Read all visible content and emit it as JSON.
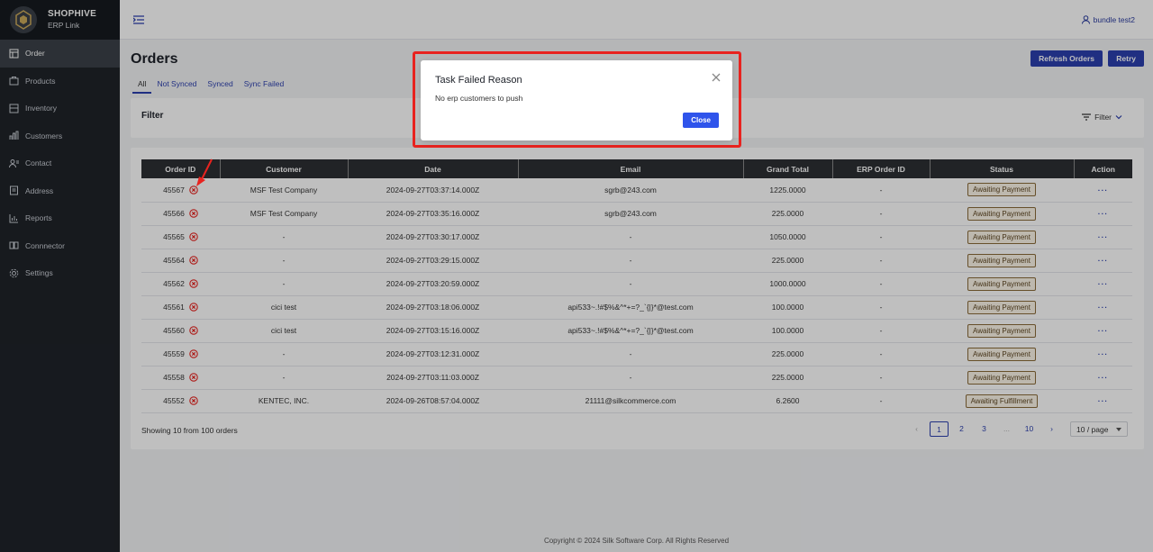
{
  "brand": {
    "name": "SHOPHIVE",
    "sub": "ERP Link"
  },
  "sidebar": {
    "items": [
      {
        "label": "Order",
        "icon": "order-icon",
        "active": true
      },
      {
        "label": "Products",
        "icon": "products-icon"
      },
      {
        "label": "Inventory",
        "icon": "inventory-icon"
      },
      {
        "label": "Customers",
        "icon": "customers-icon"
      },
      {
        "label": "Contact",
        "icon": "contact-icon"
      },
      {
        "label": "Address",
        "icon": "address-icon"
      },
      {
        "label": "Reports",
        "icon": "reports-icon"
      },
      {
        "label": "Connnector",
        "icon": "connector-icon"
      },
      {
        "label": "Settings",
        "icon": "settings-icon"
      }
    ]
  },
  "header": {
    "user": "bundle test2"
  },
  "page": {
    "title": "Orders",
    "refresh_label": "Refresh Orders",
    "retry_label": "Retry",
    "tabs": [
      "All",
      "Not Synced",
      "Synced",
      "Sync Failed"
    ]
  },
  "filter": {
    "title": "Filter",
    "toggle_label": "Filter"
  },
  "table": {
    "columns": [
      "Order ID",
      "Customer",
      "Date",
      "Email",
      "Grand Total",
      "ERP Order ID",
      "Status",
      "Action"
    ],
    "rows": [
      {
        "id": "45567",
        "customer": "MSF Test Company",
        "date": "2024-09-27T03:37:14.000Z",
        "email": "sgrb@243.com",
        "total": "1225.0000",
        "erp": "-",
        "status": "Awaiting Payment",
        "action": "···"
      },
      {
        "id": "45566",
        "customer": "MSF Test Company",
        "date": "2024-09-27T03:35:16.000Z",
        "email": "sgrb@243.com",
        "total": "225.0000",
        "erp": "-",
        "status": "Awaiting Payment",
        "action": "···"
      },
      {
        "id": "45565",
        "customer": "-",
        "date": "2024-09-27T03:30:17.000Z",
        "email": "-",
        "total": "1050.0000",
        "erp": "-",
        "status": "Awaiting Payment",
        "action": "···"
      },
      {
        "id": "45564",
        "customer": "-",
        "date": "2024-09-27T03:29:15.000Z",
        "email": "-",
        "total": "225.0000",
        "erp": "-",
        "status": "Awaiting Payment",
        "action": "···"
      },
      {
        "id": "45562",
        "customer": "-",
        "date": "2024-09-27T03:20:59.000Z",
        "email": "-",
        "total": "1000.0000",
        "erp": "-",
        "status": "Awaiting Payment",
        "action": "···"
      },
      {
        "id": "45561",
        "customer": "cici test",
        "date": "2024-09-27T03:18:06.000Z",
        "email": "api533~.!#$%&^*+=?_`{|}*@test.com",
        "total": "100.0000",
        "erp": "-",
        "status": "Awaiting Payment",
        "action": "···"
      },
      {
        "id": "45560",
        "customer": "cici test",
        "date": "2024-09-27T03:15:16.000Z",
        "email": "api533~.!#$%&^*+=?_`{|}*@test.com",
        "total": "100.0000",
        "erp": "-",
        "status": "Awaiting Payment",
        "action": "···"
      },
      {
        "id": "45559",
        "customer": "-",
        "date": "2024-09-27T03:12:31.000Z",
        "email": "-",
        "total": "225.0000",
        "erp": "-",
        "status": "Awaiting Payment",
        "action": "···"
      },
      {
        "id": "45558",
        "customer": "-",
        "date": "2024-09-27T03:11:03.000Z",
        "email": "-",
        "total": "225.0000",
        "erp": "-",
        "status": "Awaiting Payment",
        "action": "···"
      },
      {
        "id": "45552",
        "customer": "KENTEC, INC.",
        "date": "2024-09-26T08:57:04.000Z",
        "email": "21111@silkcommerce.com",
        "total": "6.2600",
        "erp": "-",
        "status": "Awaiting Fulfillment",
        "action": "···"
      }
    ]
  },
  "pagination": {
    "showing": "Showing 10 from 100 orders",
    "prev": "‹",
    "pages": [
      "1",
      "2",
      "3",
      "...",
      "10"
    ],
    "current": "1",
    "next": "›",
    "page_size": "10 / page"
  },
  "footer": {
    "text": "Copyright © 2024 Silk Software Corp. All Rights Reserved"
  },
  "modal": {
    "title": "Task Failed Reason",
    "body": "No erp customers to push",
    "close_label": "Close"
  },
  "colors": {
    "primary": "#2b3fae",
    "error": "#e8231f",
    "sidebar": "#1f2329"
  }
}
